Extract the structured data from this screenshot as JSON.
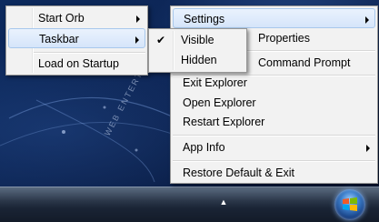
{
  "main_menu": {
    "items": [
      {
        "label": "Start Orb",
        "has_submenu": true
      },
      {
        "label": "Taskbar",
        "has_submenu": true,
        "selected": true
      },
      {
        "label": "Load on Startup",
        "has_submenu": false
      }
    ]
  },
  "taskbar_menu": {
    "items": [
      {
        "label": "Visible",
        "checked": true
      },
      {
        "label": "Hidden",
        "checked": false
      }
    ],
    "check_glyph": "✔"
  },
  "context_menu": {
    "items": [
      {
        "label": "Settings",
        "has_submenu": true,
        "selected": true
      },
      {
        "label": "Properties",
        "has_submenu": false
      },
      {
        "label": "Command Prompt",
        "has_submenu": false
      },
      {
        "label": "Exit Explorer",
        "has_submenu": false
      },
      {
        "label": "Open Explorer",
        "has_submenu": false
      },
      {
        "label": "Restart Explorer",
        "has_submenu": false
      },
      {
        "label": "App Info",
        "has_submenu": true
      },
      {
        "label": "Restore Default & Exit",
        "has_submenu": false
      }
    ]
  },
  "desktop": {
    "wallpaper_text": "WEB ENTERTAINMENT"
  },
  "taskbar": {
    "tray_arrow": "▲",
    "start_orb_icon": "windows-logo-icon"
  },
  "colors": {
    "menu_bg": "#f2f2f2",
    "menu_border": "#979797",
    "highlight_border": "#a8c8ec",
    "desktop_bg": "#0a1f49"
  }
}
